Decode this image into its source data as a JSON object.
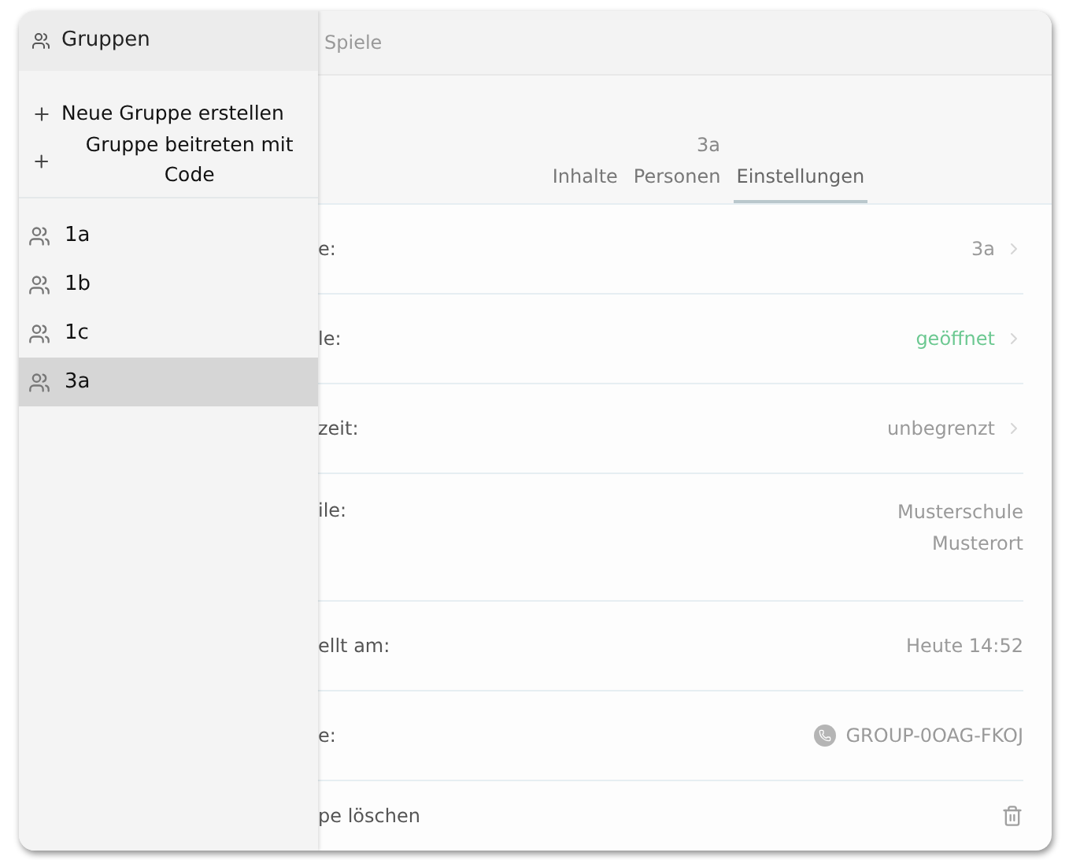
{
  "top_bar": {
    "tab_label": "Spiele"
  },
  "header": {
    "title": "3a",
    "tabs": [
      {
        "label": "Inhalte",
        "selected": false
      },
      {
        "label": "Personen",
        "selected": false
      },
      {
        "label": "Einstellungen",
        "selected": true
      }
    ]
  },
  "settings": [
    {
      "kind": "link",
      "label": "e:",
      "value": "3a"
    },
    {
      "kind": "status",
      "label": "le:",
      "value": "geöffnet"
    },
    {
      "kind": "link",
      "label": "zeit:",
      "value": "unbegrenzt"
    },
    {
      "kind": "multiline",
      "label": "ile:",
      "lines": [
        "Musterschule",
        "Musterort"
      ]
    },
    {
      "kind": "plain",
      "label": "ellt am:",
      "value": "Heute 14:52"
    },
    {
      "kind": "code",
      "label": "e:",
      "value": "GROUP-0OAG-FKOJ"
    },
    {
      "kind": "delete",
      "label": "pe löschen"
    }
  ],
  "sidebar": {
    "title": "Gruppen",
    "actions": [
      "Neue Gruppe erstellen",
      "Gruppe beitreten mit Code"
    ],
    "groups": [
      {
        "name": "1a",
        "selected": false
      },
      {
        "name": "1b",
        "selected": false
      },
      {
        "name": "1c",
        "selected": false
      },
      {
        "name": "3a",
        "selected": true
      }
    ]
  }
}
